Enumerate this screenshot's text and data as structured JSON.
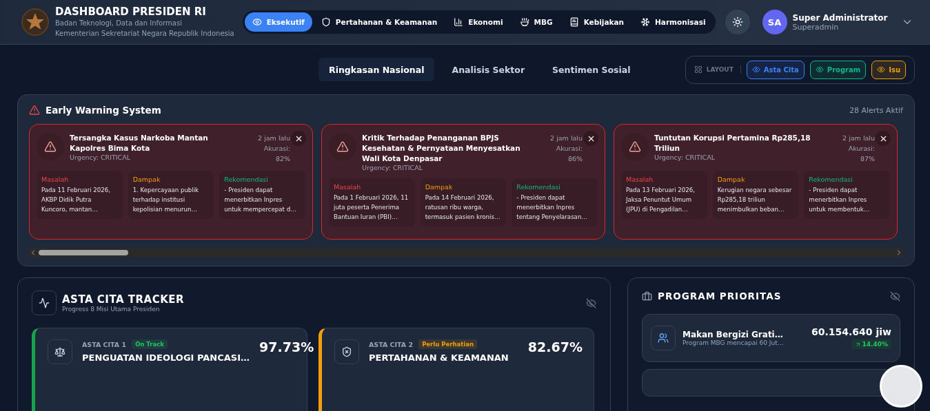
{
  "header": {
    "title": "DASHBOARD PRESIDEN RI",
    "subtitle_lines": [
      "Badan Teknologi, Data dan Informasi",
      "Kementerian Sekretariat Negara Republik Indonesia"
    ],
    "nav": [
      {
        "label": "Eksekutif",
        "selected": true
      },
      {
        "label": "Pertahanan & Keamanan",
        "selected": false
      },
      {
        "label": "Ekonomi",
        "selected": false
      },
      {
        "label": "MBG",
        "selected": false
      },
      {
        "label": "Kebijakan",
        "selected": false
      },
      {
        "label": "Harmonisasi",
        "selected": false
      }
    ],
    "user": {
      "initials": "SA",
      "name": "Super Administrator",
      "role": "Superadmin"
    }
  },
  "view_tabs": [
    {
      "label": "Ringkasan Nasional",
      "selected": true
    },
    {
      "label": "Analisis Sektor",
      "selected": false
    },
    {
      "label": "Sentimen Sosial",
      "selected": false
    }
  ],
  "layout": {
    "label": "LAYOUT",
    "toggles": [
      {
        "label": "Asta Cita",
        "color": "#3b82f6"
      },
      {
        "label": "Program",
        "color": "#10b981"
      },
      {
        "label": "Isu",
        "color": "#f59e0b"
      }
    ]
  },
  "early_warning": {
    "title": "Early Warning System",
    "count": "28 Alerts Aktif",
    "alerts": [
      {
        "title": "Tersangka Kasus Narkoba Mantan Kapolres Bima Kota",
        "urgency": "Urgency: CRITICAL",
        "time": "2 jam lalu",
        "accuracy": "Akurasi: 82%",
        "sections": [
          {
            "kind": "problem",
            "heading": "Masalah",
            "text": "Pada 11 Februari 2026, AKBP Didik Putra Kuncoro, mantan…"
          },
          {
            "kind": "impact",
            "heading": "Dampak",
            "text": "1. Kepercayaan publik terhadap institusi kepolisian menurun…"
          },
          {
            "kind": "recommendation",
            "heading": "Rekomendasi",
            "text": "- Presiden dapat menerbitkan Inpres untuk mempercepat d…"
          }
        ]
      },
      {
        "title": "Kritik Terhadap Penanganan BPJS Kesehatan & Pernyataan Menyesatkan Wali Kota Denpasar",
        "urgency": "Urgency: CRITICAL",
        "time": "2 jam lalu",
        "accuracy": "Akurasi: 86%",
        "sections": [
          {
            "kind": "problem",
            "heading": "Masalah",
            "text": "Pada 1 Februari 2026, 11 juta peserta Penerima Bantuan Iuran (PBI)…"
          },
          {
            "kind": "impact",
            "heading": "Dampak",
            "text": "Pada 14 Februari 2026, ratusan ribu warga, termasuk pasien kronis…"
          },
          {
            "kind": "recommendation",
            "heading": "Rekomendasi",
            "text": "- Presiden dapat menerbitkan Inpres tentang Penyelarasan…"
          }
        ]
      },
      {
        "title": "Tuntutan Korupsi Pertamina Rp285,18 Triliun",
        "urgency": "Urgency: CRITICAL",
        "time": "2 jam lalu",
        "accuracy": "Akurasi: 87%",
        "sections": [
          {
            "kind": "problem",
            "heading": "Masalah",
            "text": "Pada 13 Februari 2026, Jaksa Penuntut Umum (JPU) di Pengadilan…"
          },
          {
            "kind": "impact",
            "heading": "Dampak",
            "text": "Kerugian negara sebesar Rp285,18 triliun menimbulkan beban…"
          },
          {
            "kind": "recommendation",
            "heading": "Rekomendasi",
            "text": "- Presiden dapat menerbitkan Inpres untuk membentuk…"
          }
        ]
      }
    ]
  },
  "asta_cita": {
    "title": "ASTA CITA TRACKER",
    "subtitle": "Progress 8 Misi Utama Presiden",
    "items": [
      {
        "kind": "on_track",
        "label": "ASTA CITA 1",
        "status": "On Track",
        "name": "PENGUATAN IDEOLOGI PANCASI…",
        "percent": "97.73%"
      },
      {
        "kind": "attention",
        "label": "ASTA CITA 2",
        "status": "Perlu Perhatian",
        "name": "PERTAHANAN & KEAMANAN",
        "percent": "82.67%"
      }
    ]
  },
  "program": {
    "title": "PROGRAM PRIORITAS",
    "items": [
      {
        "name": "Makan Bergizi Grati…",
        "description": "Program MBG mencapai 60 Jut…",
        "value": "60.154.640 jiw",
        "change": "14.40%"
      }
    ]
  }
}
